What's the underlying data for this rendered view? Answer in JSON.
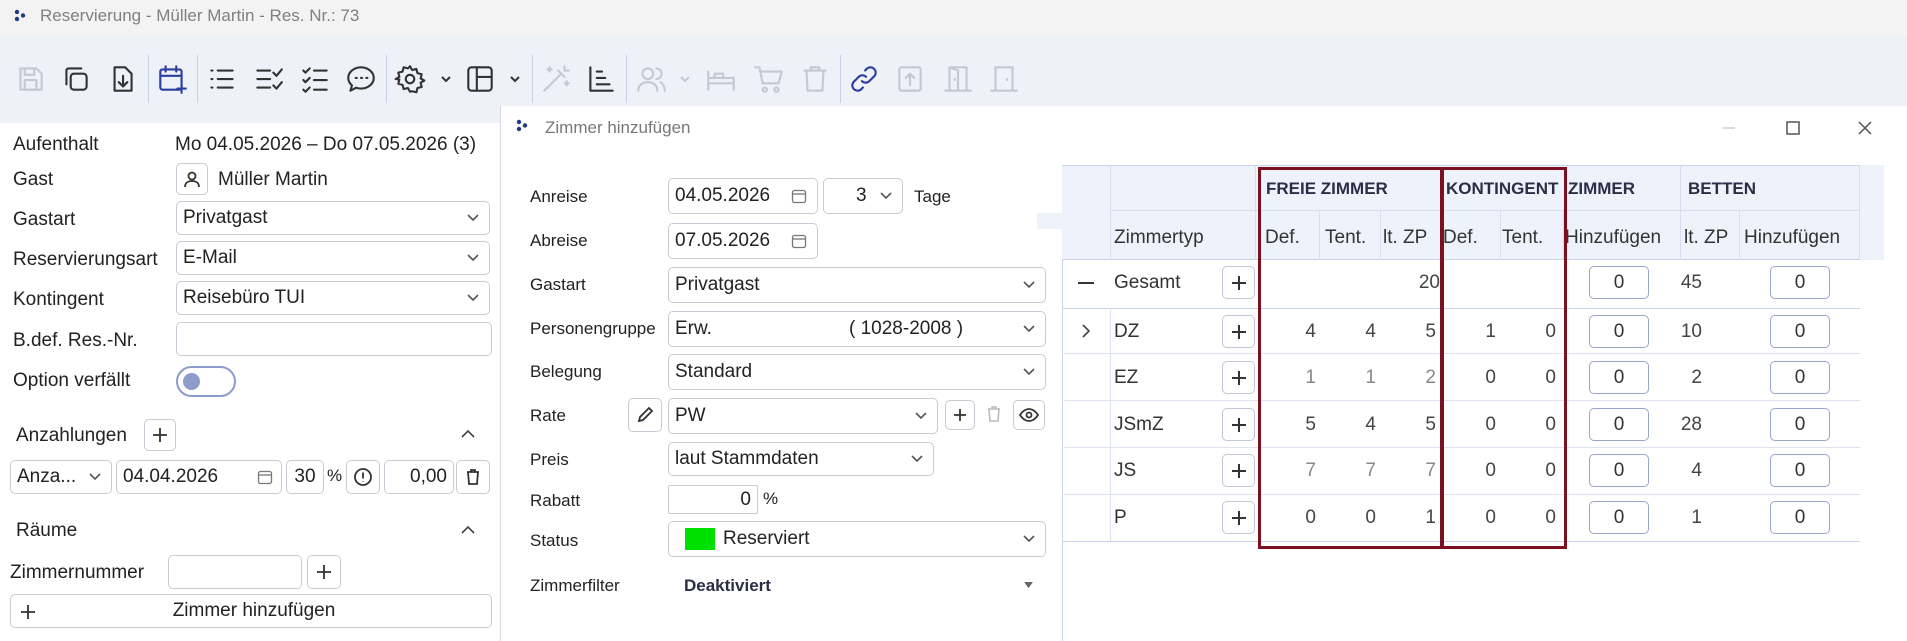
{
  "window": {
    "title": "Reservierung - Müller Martin - Res. Nr.: 73"
  },
  "toolbar": {
    "buttons": [
      "save-icon",
      "copy-icon",
      "import-icon",
      "calendar-add-icon",
      "list-icon",
      "list-check-icon",
      "checklist-icon",
      "chat-icon",
      "gear-icon",
      "layout-icon",
      "magic-wand-icon",
      "chart-icon",
      "users-icon",
      "bed-icon",
      "cart-icon",
      "trash-icon",
      "link-icon",
      "upload-icon",
      "door-open-icon",
      "door-icon"
    ]
  },
  "left": {
    "aufenthalt": {
      "label": "Aufenthalt",
      "value": "Mo 04.05.2026 – Do 07.05.2026 (3)"
    },
    "gast": {
      "label": "Gast",
      "value": "Müller Martin"
    },
    "gastart": {
      "label": "Gastart",
      "value": "Privatgast"
    },
    "reservierungsart": {
      "label": "Reservierungsart",
      "value": "E-Mail"
    },
    "kontingent": {
      "label": "Kontingent",
      "value": "Reisebüro TUI"
    },
    "bdef": {
      "label": "B.def. Res.-Nr.",
      "value": ""
    },
    "option": {
      "label": "Option verfällt",
      "on": false
    },
    "anzahlungen": {
      "label": "Anzahlungen",
      "type": "Anza...",
      "date": "04.04.2026",
      "percent": "30",
      "percent_sign": "%",
      "amount": "0,00"
    },
    "raeume": {
      "label": "Räume",
      "zimmernummer_label": "Zimmernummer",
      "zimmernummer_value": "",
      "add_label": "Zimmer hinzufügen"
    }
  },
  "dialog": {
    "title": "Zimmer hinzufügen",
    "anreise": {
      "label": "Anreise",
      "value": "04.05.2026",
      "nights": "3",
      "nights_unit": "Tage"
    },
    "abreise": {
      "label": "Abreise",
      "value": "07.05.2026"
    },
    "gastart": {
      "label": "Gastart",
      "value": "Privatgast"
    },
    "personengruppe": {
      "label": "Personengruppe",
      "value": "Erw.",
      "range": "( 1028-2008 )"
    },
    "belegung": {
      "label": "Belegung",
      "value": "Standard"
    },
    "rate": {
      "label": "Rate",
      "value": "PW"
    },
    "preis": {
      "label": "Preis",
      "value": "laut Stammdaten"
    },
    "rabatt": {
      "label": "Rabatt",
      "value": "0",
      "unit": "%"
    },
    "status": {
      "label": "Status",
      "value": "Reserviert",
      "color": "#00e000"
    },
    "zimmerfilter": {
      "label": "Zimmerfilter",
      "value": "Deaktiviert"
    }
  },
  "grid": {
    "groups": {
      "freie": "FREIE ZIMMER",
      "kontingent": "KONTINGENT",
      "zimmer": "ZIMMER",
      "betten": "BETTEN"
    },
    "columns": {
      "zimmertyp": "Zimmertyp",
      "def": "Def.",
      "tent": "Tent.",
      "ltzp": "lt. ZP",
      "kdef": "Def.",
      "ktent": "Tent.",
      "hinzufuegen": "Hinzufügen",
      "bltzp": "lt. ZP",
      "bhinzufuegen": "Hinzufügen"
    },
    "total": {
      "label": "Gesamt",
      "ltzp": "20",
      "zimmer": "0",
      "betten_ltzp": "45",
      "betten": "0"
    },
    "rows": [
      {
        "type": "DZ",
        "def": "4",
        "tent": "4",
        "ltzp": "5",
        "kdef": "1",
        "ktent": "0",
        "zimmer": "0",
        "bltzp": "10",
        "betten": "0"
      },
      {
        "type": "EZ",
        "def": "1",
        "tent": "1",
        "ltzp": "2",
        "kdef": "0",
        "ktent": "0",
        "zimmer": "0",
        "bltzp": "2",
        "betten": "0"
      },
      {
        "type": "JSmZ",
        "def": "5",
        "tent": "4",
        "ltzp": "5",
        "kdef": "0",
        "ktent": "0",
        "zimmer": "0",
        "bltzp": "28",
        "betten": "0"
      },
      {
        "type": "JS",
        "def": "7",
        "tent": "7",
        "ltzp": "7",
        "kdef": "0",
        "ktent": "0",
        "zimmer": "0",
        "bltzp": "4",
        "betten": "0"
      },
      {
        "type": "P",
        "def": "0",
        "tent": "0",
        "ltzp": "1",
        "kdef": "0",
        "ktent": "0",
        "zimmer": "0",
        "bltzp": "1",
        "betten": "0"
      }
    ]
  },
  "colors": {
    "highlight": "#7a1020",
    "accent": "#2c3e9e",
    "toggle": "#8e9cc9"
  }
}
